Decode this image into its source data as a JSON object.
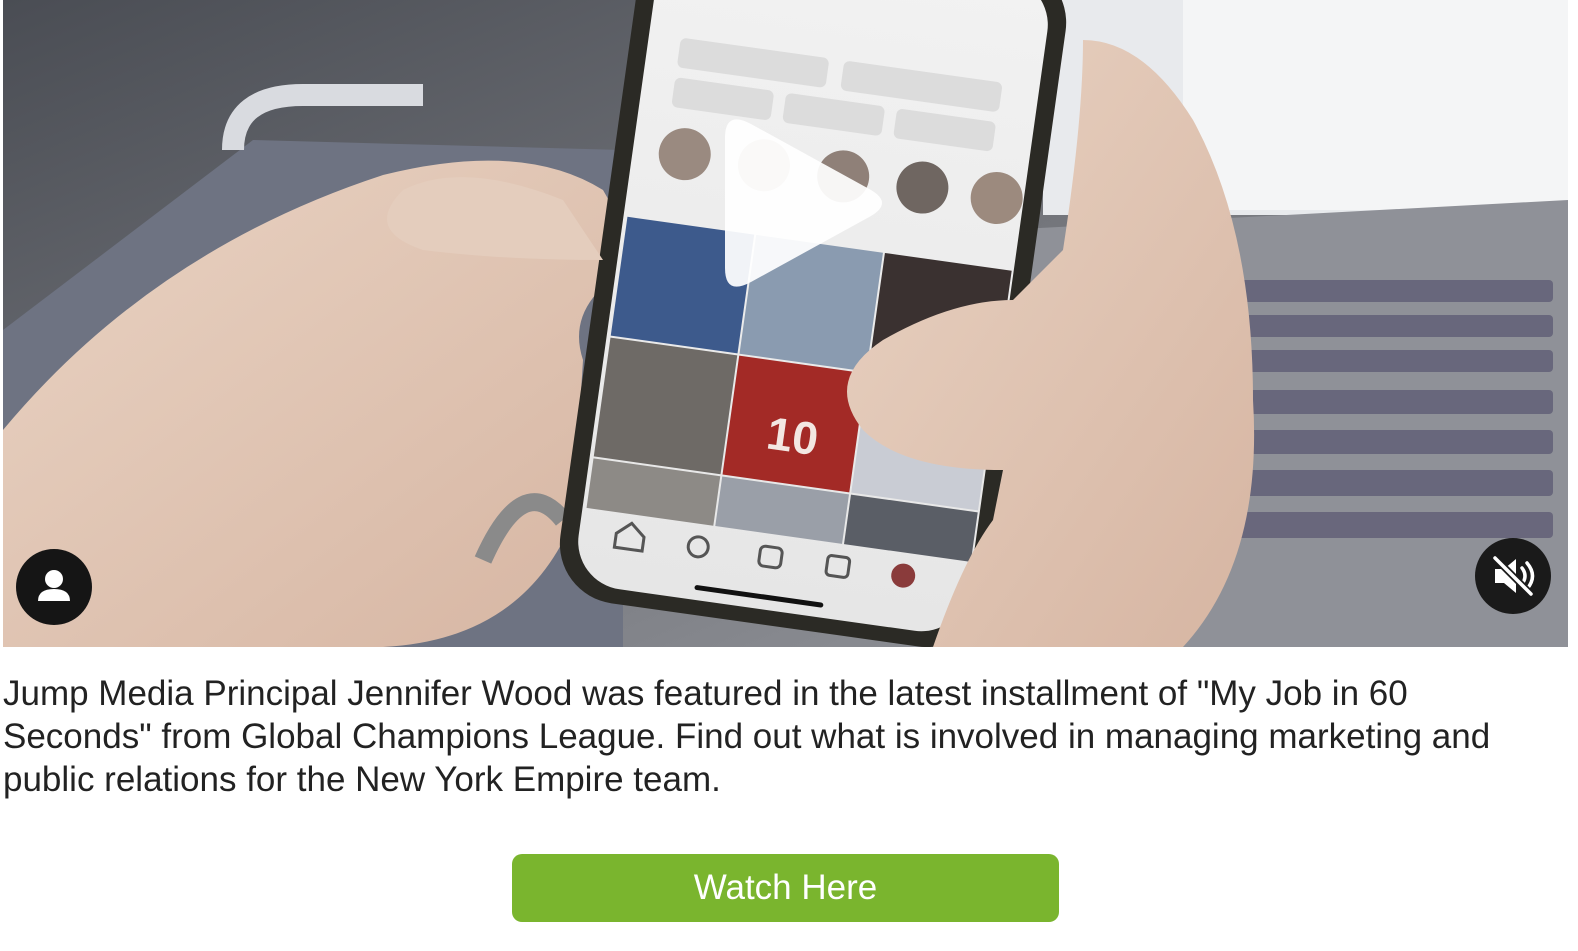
{
  "video": {
    "controls": {
      "play_icon": "play-icon",
      "avatar_icon": "user-icon",
      "mute_icon": "speaker-muted-icon"
    }
  },
  "caption": {
    "text": "Jump Media Principal Jennifer Wood was featured in the latest installment of \"My Job in 60 Seconds\" from Global Champions League. Find out what is involved in managing marketing and public relations for the New York Empire team."
  },
  "cta": {
    "label": "Watch Here",
    "color": "#7ab52e"
  }
}
